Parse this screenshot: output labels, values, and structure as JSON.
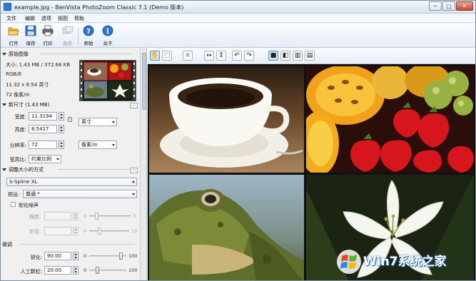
{
  "window": {
    "title": "example.jpg - BenVista PhotoZoom Classic 7.1 (Demo 版本)",
    "controls": [
      "─",
      "□",
      "✕"
    ]
  },
  "menu": [
    "文件",
    "编辑",
    "选项",
    "视图",
    "帮助"
  ],
  "toolbar": {
    "buttons": [
      {
        "label": "打开",
        "icon": "folder-open-icon",
        "enabled": true
      },
      {
        "label": "保存",
        "icon": "floppy-disk-icon",
        "enabled": true
      },
      {
        "label": "打印",
        "icon": "printer-icon",
        "enabled": true
      },
      {
        "label": "批处",
        "icon": "batch-icon",
        "enabled": false
      },
      {
        "label": "帮助",
        "icon": "help-icon",
        "enabled": true
      },
      {
        "label": "关于",
        "icon": "info-icon",
        "enabled": true
      }
    ]
  },
  "original_image": {
    "header": "原始图像",
    "size": "大小: 1.43 MB / 372.66 KB",
    "color": "RGB/8",
    "dimensions": "11.32 x 8.54 英寸",
    "resolution": "72 像素/in"
  },
  "new_size": {
    "header": "新尺寸 (1.43 MB)",
    "width_label": "宽度:",
    "width_value": "11.3194",
    "height_label": "高度:",
    "height_value": "8.5417",
    "unit": "英寸",
    "resolution_label": "分辨率:",
    "resolution_value": "72",
    "resolution_unit": "像素/in",
    "aspect_label": "宽高比:",
    "aspect_value": "约束比例"
  },
  "resize_method": {
    "header": "调整大小的方式",
    "method": "S-Spline XL",
    "preset_label": "预设:",
    "preset_value": "普通 *",
    "soften_label": "软化噪声",
    "strength_label": "强度:",
    "strength_min": "0",
    "strength_max": "5",
    "radius_label": "半径:",
    "radius_min": "0",
    "radius_max": "10"
  },
  "fine_tune": {
    "header": "微调",
    "sharpness_label": "锐化:",
    "sharpness_value": "90.00",
    "sharpness_min": "0",
    "sharpness_max": "100",
    "sharpness_level": 0.9,
    "grain_label": "人工颗粒:",
    "grain_value": "20.00",
    "grain_min": "0",
    "grain_max": "100",
    "grain_level": 0.2
  },
  "view_toolbar": {
    "buttons": [
      {
        "icon": "hand-pan-icon",
        "on": true
      },
      {
        "icon": "zoom-select-icon",
        "on": false
      },
      {
        "icon": "crop-icon",
        "on": false
      },
      {
        "icon": "flip-horizontal-icon",
        "on": false
      },
      {
        "icon": "flip-vertical-icon",
        "on": false
      },
      {
        "icon": "rotate-left-icon",
        "on": false
      },
      {
        "icon": "rotate-right-icon",
        "on": false
      },
      {
        "icon": "single-view-icon",
        "on": true
      },
      {
        "icon": "split-vertical-icon",
        "on": false
      },
      {
        "icon": "dual-view-icon",
        "on": false
      },
      {
        "icon": "split-horizontal-icon",
        "on": false
      }
    ]
  },
  "watermark": {
    "brand": "Win7系统之家"
  },
  "colors": {
    "accent": "#2a7ed8",
    "panel": "#f0f0f0",
    "toolbar_gradient_top": "#fbfcfe"
  }
}
